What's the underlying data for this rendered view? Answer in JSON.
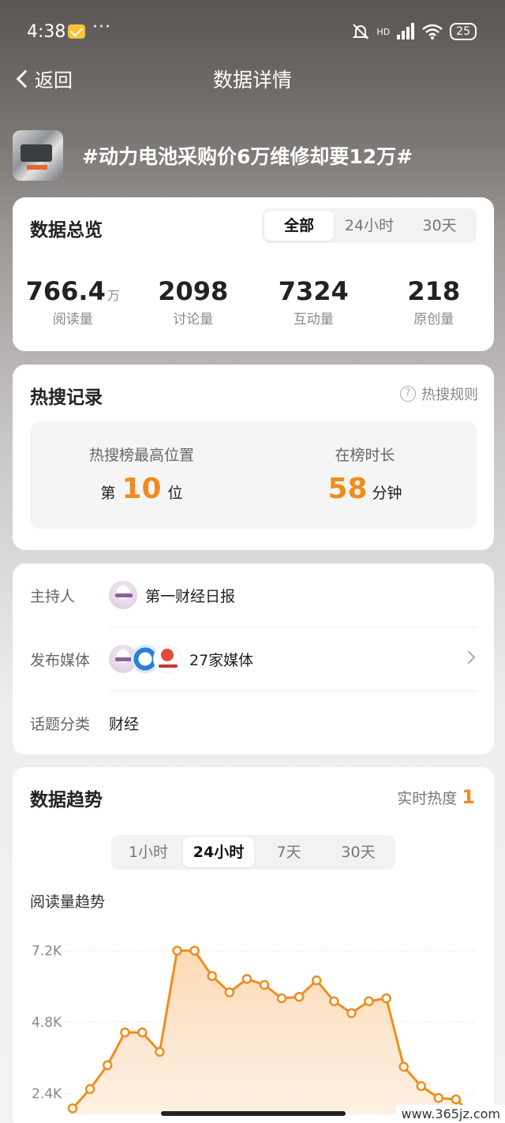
{
  "status": {
    "time": "4:38",
    "more": "···",
    "hd": "HD",
    "battery": "25"
  },
  "nav": {
    "back_label": "返回",
    "title": "数据详情"
  },
  "topic": {
    "title": "#动力电池采购价6万维修却要12万#"
  },
  "overview": {
    "title": "数据总览",
    "tabs": [
      "全部",
      "24小时",
      "30天"
    ],
    "active_tab": "全部",
    "stats": [
      {
        "value": "766.4",
        "unit": "万",
        "label": "阅读量"
      },
      {
        "value": "2098",
        "unit": "",
        "label": "讨论量"
      },
      {
        "value": "7324",
        "unit": "",
        "label": "互动量"
      },
      {
        "value": "218",
        "unit": "",
        "label": "原创量"
      }
    ]
  },
  "hot_search": {
    "title": "热搜记录",
    "rules_label": "热搜规则",
    "highest": {
      "label": "热搜榜最高位置",
      "prefix": "第",
      "value": "10",
      "suffix": "位"
    },
    "duration": {
      "label": "在榜时长",
      "value": "58",
      "suffix": "分钟"
    }
  },
  "info": {
    "host_label": "主持人",
    "host_name": "第一财经日报",
    "media_label": "发布媒体",
    "media_count": "27家媒体",
    "category_label": "话题分类",
    "category_value": "财经"
  },
  "trend": {
    "title": "数据趋势",
    "heat_label": "实时热度",
    "heat_value": "1",
    "tabs": [
      "1小时",
      "24小时",
      "7天",
      "30天"
    ],
    "active_tab": "24小时",
    "chart_title": "阅读量趋势"
  },
  "chart_data": {
    "type": "area",
    "title": "阅读量趋势",
    "y_ticks": [
      "2.4K",
      "4.8K",
      "7.2K"
    ],
    "ylim": [
      1700,
      7800
    ],
    "grid": true,
    "color": "#f08c1e",
    "values": [
      1900,
      2550,
      3350,
      4450,
      4450,
      3800,
      7200,
      7200,
      6350,
      5800,
      6250,
      6050,
      5600,
      5650,
      6200,
      5500,
      5100,
      5500,
      5600,
      3300,
      2650,
      2250,
      2200,
      1650
    ]
  },
  "watermark": "www.365jz.com"
}
